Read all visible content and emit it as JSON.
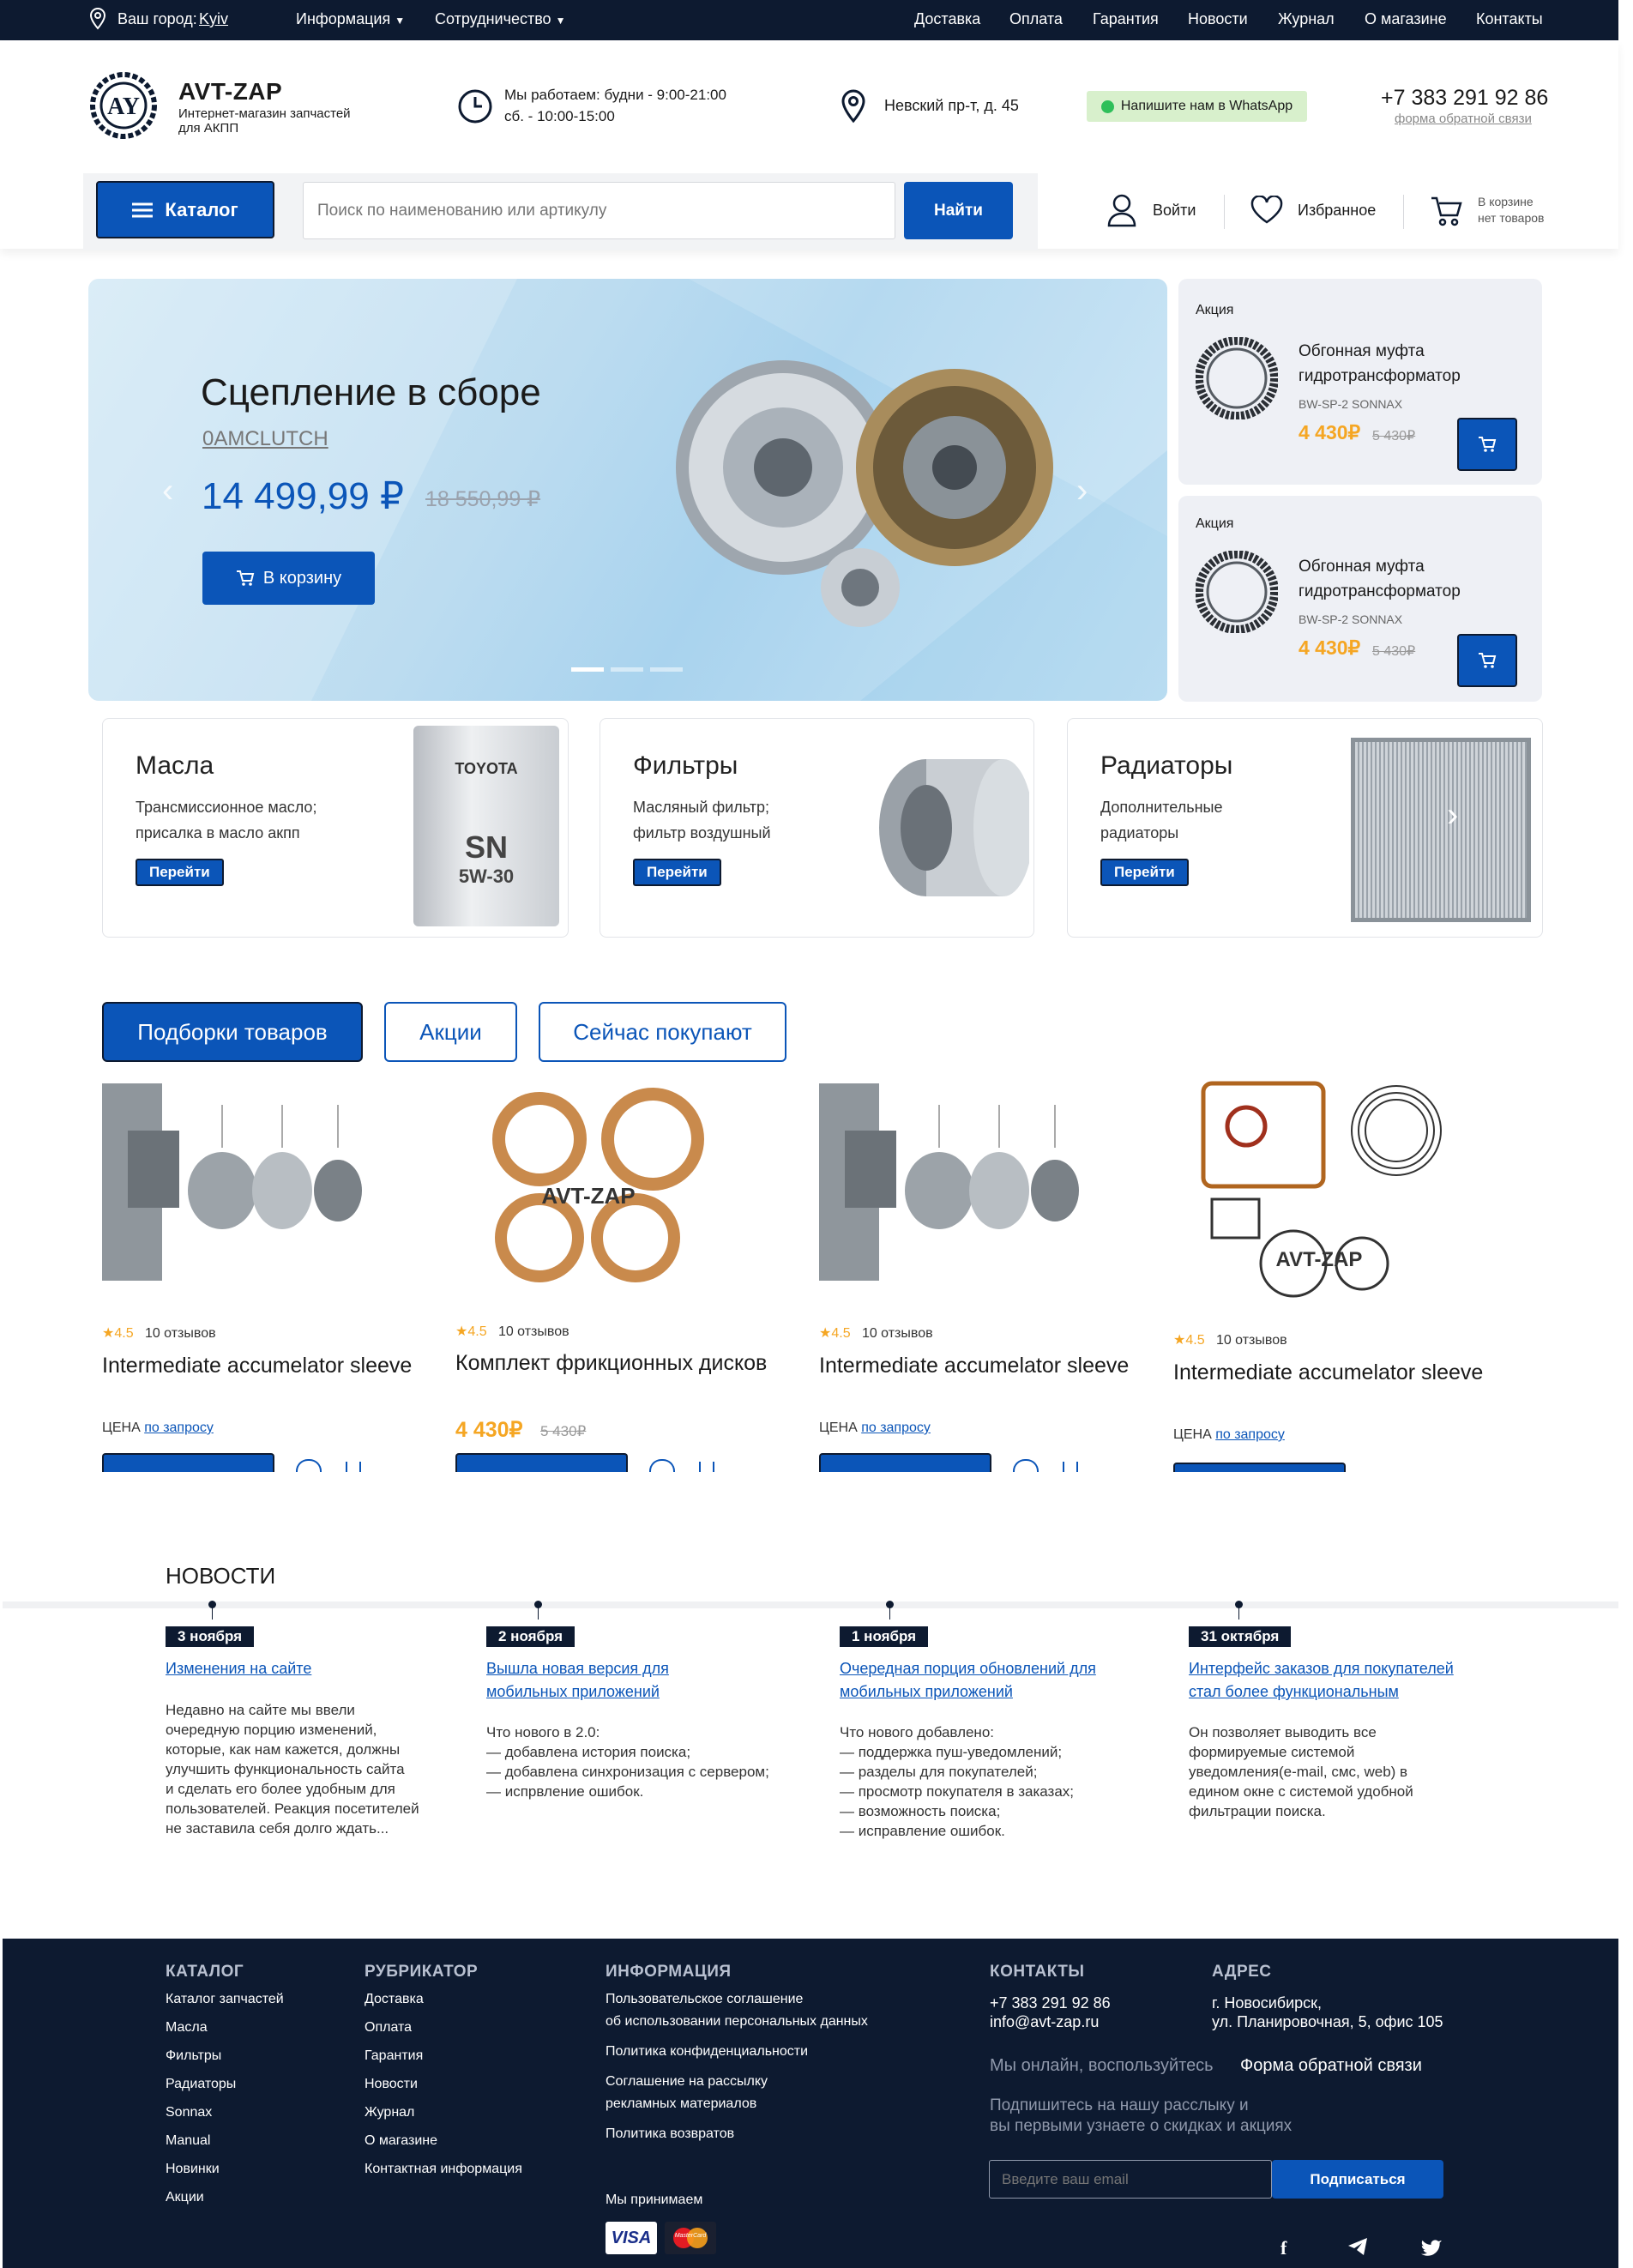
{
  "topbar": {
    "city_label": "Ваш город:",
    "city": "Kyiv",
    "info": "Информация",
    "coop": "Сотрудничество",
    "links": [
      "Доставка",
      "Оплата",
      "Гарантия",
      "Новости",
      "Журнал",
      "О магазине",
      "Контакты"
    ]
  },
  "header": {
    "brand": "AVT-ZAP",
    "tagline1": "Интернет-магазин запчастей",
    "tagline2": "для АКПП",
    "hours1": "Мы работаем: будни - 9:00-21:00",
    "hours2": "сб. - 10:00-15:00",
    "address": "Невский пр-т, д. 45",
    "whatsapp": "Напишите нам в WhatsApp",
    "phone": "+7 383 291 92 86",
    "feedback": "форма обратной связи"
  },
  "nav": {
    "catalog": "Каталог",
    "search_placeholder": "Поиск по наименованию или артикулу",
    "search_btn": "Найти",
    "login": "Войти",
    "favorites": "Избранное",
    "cart1": "В корзине",
    "cart2": "нет товаров"
  },
  "hero": {
    "title": "Сцепление в сборе",
    "sku": "0AMCLUTCH",
    "price": "14 499,99 ₽",
    "old_price": "18 550,99 ₽",
    "cart_btn": "В корзину"
  },
  "promos": [
    {
      "tag": "Акция",
      "name1": "Обгонная муфта",
      "name2": "гидротрансформатор",
      "sku": "BW-SP-2 SONNAX",
      "price": "4 430₽",
      "old": "5 430₽"
    },
    {
      "tag": "Акция",
      "name1": "Обгонная муфта",
      "name2": "гидротрансформатор",
      "sku": "BW-SP-2 SONNAX",
      "price": "4 430₽",
      "old": "5 430₽"
    }
  ],
  "categories": [
    {
      "title": "Масла",
      "d1": "Трансмиссионное масло;",
      "d2": "присалка в масло акпп",
      "btn": "Перейти",
      "img1": "TOYOTA",
      "img2": "SN",
      "img3": "5W-30"
    },
    {
      "title": "Фильтры",
      "d1": "Масляный фильтр;",
      "d2": "фильтр воздушный",
      "btn": "Перейти"
    },
    {
      "title": "Радиаторы",
      "d1": "Дополнительные",
      "d2": "радиаторы",
      "btn": "Перейти"
    }
  ],
  "tabs": [
    "Подборки товаров",
    "Акции",
    "Сейчас покупают"
  ],
  "products": [
    {
      "rating": "4.5",
      "reviews": "10 отзывов",
      "title": "Intermediate accumelator sleeve",
      "price_label": "ЦЕНА",
      "price_link": "по запросу"
    },
    {
      "rating": "4.5",
      "reviews": "10 отзывов",
      "title": "Комплект фрикционных дисков",
      "price": "4 430₽",
      "old": "5 430₽",
      "watermark": "AVT-ZAP"
    },
    {
      "rating": "4.5",
      "reviews": "10 отзывов",
      "title": "Intermediate accumelator sleeve",
      "price_label": "ЦЕНА",
      "price_link": "по запросу"
    },
    {
      "rating": "4.5",
      "reviews": "10 отзывов",
      "title": "Intermediate accumelator sleeve",
      "price_label": "ЦЕНА",
      "price_link": "по запросу",
      "watermark": "AVT-ZAP"
    }
  ],
  "news": {
    "heading": "НОВОСТИ",
    "items": [
      {
        "date": "3 ноября",
        "l1": "Изменения на сайте",
        "l2": "",
        "body": "Недавно на сайте мы ввели\nочередную порцию изменений,\nкоторые, как нам кажется, должны\nулучшить функциональность сайта\nи сделать его более удобным для\nпользователей. Реакция посетителей\nне заставила себя долго ждать..."
      },
      {
        "date": "2 ноября",
        "l1": "Вышла новая версия для",
        "l2": "мобильных приложений",
        "body": "Что нового в 2.0:\n— добавлена история поиска;\n— добавлена синхронизация с сервером;\n— испрвление ошибок."
      },
      {
        "date": "1 ноября",
        "l1": "Очередная порция обновлений для",
        "l2": "мобильных приложений",
        "body": "Что нового добавлено:\n— поддержка пуш-уведомлений;\n— разделы для покупателей;\n— просмотр покупателя в заказах;\n— возможность поиска;\n— исправление ошибок."
      },
      {
        "date": "31 октября",
        "l1": "Интерфейс заказов для покупателей",
        "l2": "стал более функциональным",
        "body": "Он позволяет выводить все\nформируемые системой\nуведомления(e-mail, смс, web) в\nедином окне с системой удобной\nфильтрации поиска."
      }
    ]
  },
  "footer": {
    "catalog_h": "КАТАЛОГ",
    "catalog": [
      "Каталог запчастей",
      "Масла",
      "Фильтры",
      "Радиаторы",
      "Sonnax",
      "Manual",
      "Новинки",
      "Акции"
    ],
    "rub_h": "РУБРИКАТОР",
    "rub": [
      "Доставка",
      "Оплата",
      "Гарантия",
      "Новости",
      "Журнал",
      "О магазине",
      "Контактная информация"
    ],
    "info_h": "ИНФОРМАЦИЯ",
    "info": [
      "Пользовательское соглашение",
      "об использовании персональных данных",
      "Политика конфиденциальности",
      "Соглашение на рассылку",
      "рекламных материалов",
      "Политика возвратов"
    ],
    "accept": "Мы принимаем",
    "visa": "VISA",
    "mc": "MasterCard",
    "contacts_h": "КОНТАКТЫ",
    "phone": "+7 383 291 92 86",
    "email": "info@avt-zap.ru",
    "addr_h": "АДРЕС",
    "addr1": "г. Новосибирск,",
    "addr2": "ул. Планировочная, 5, офис 105",
    "online": "Мы онлайн, воспользуйтесь",
    "feedback": "Форма обратной связи",
    "sub1": "Подпишитесь на нашу расслыку и",
    "sub2": "вы первыми узнаете о скидках и акциях",
    "email_placeholder": "Введите ваш email",
    "subscribe": "Подписаться"
  }
}
